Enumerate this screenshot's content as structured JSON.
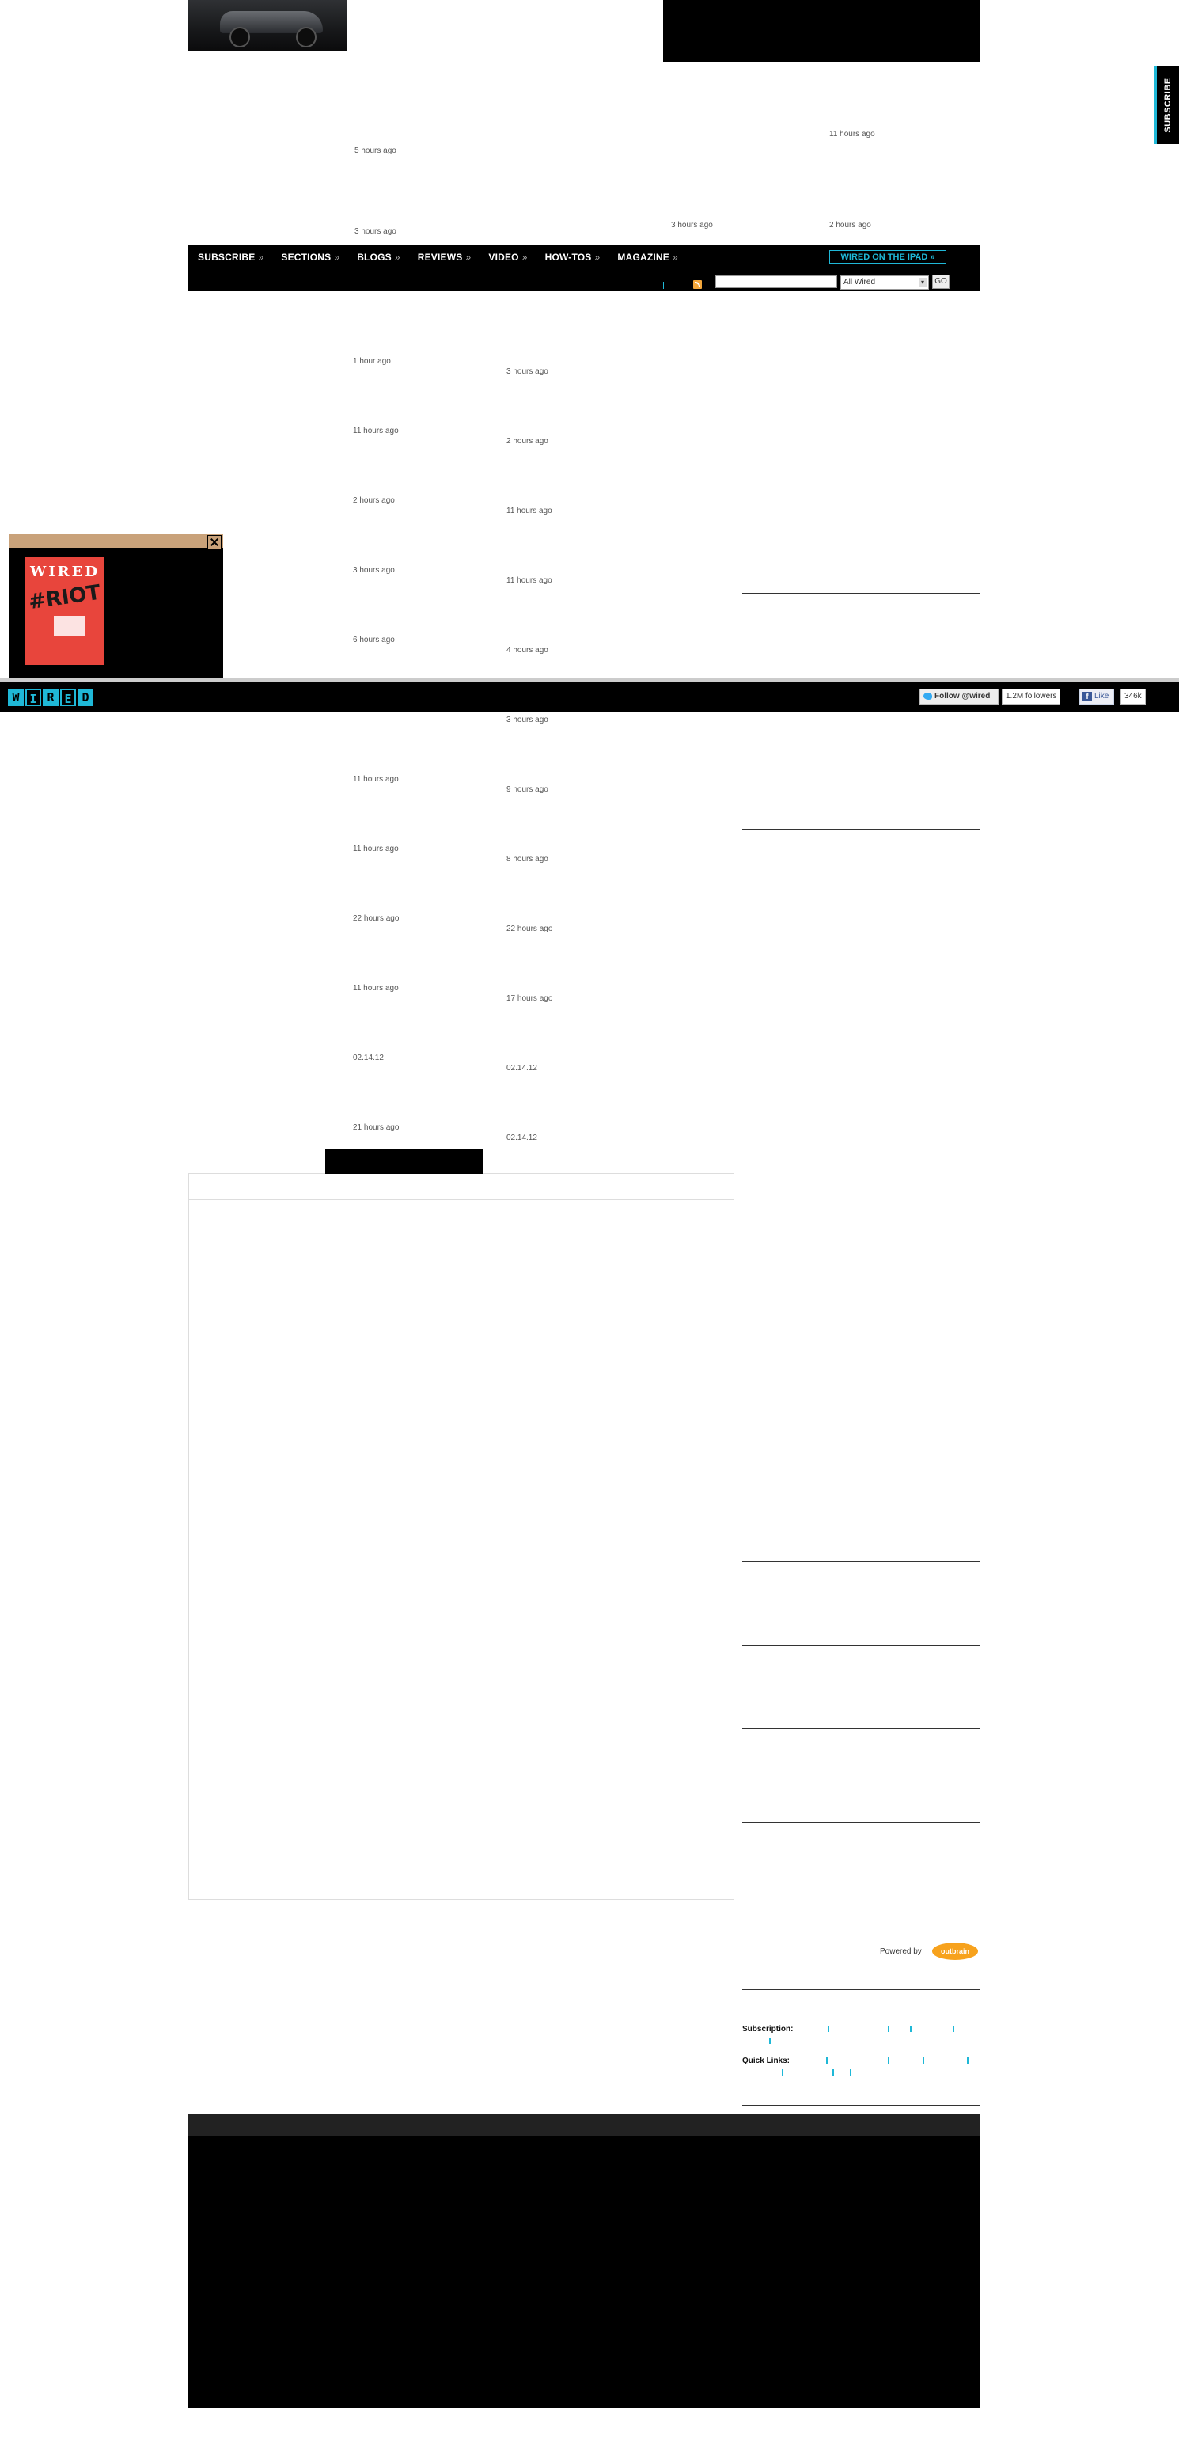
{
  "side_tab": {
    "label": "SUBSCRIBE"
  },
  "nav": {
    "items": [
      {
        "label": "SUBSCRIBE"
      },
      {
        "label": "SECTIONS"
      },
      {
        "label": "BLOGS"
      },
      {
        "label": "REVIEWS"
      },
      {
        "label": "VIDEO"
      },
      {
        "label": "HOW-TOS"
      },
      {
        "label": "MAGAZINE"
      }
    ],
    "ipad_label": "WIRED ON THE IPAD",
    "search_placeholder": "",
    "search_scope": "All Wired",
    "go_label": "GO"
  },
  "timestamps": {
    "hero": [
      "11 hours ago",
      "5 hours ago",
      "3 hours ago",
      "3 hours ago",
      "2 hours ago"
    ],
    "left_col": [
      "1 hour ago",
      "11 hours ago",
      "2 hours ago",
      "3 hours ago",
      "6 hours ago",
      "11 hours ago",
      "11 hours ago",
      "22 hours ago",
      "11 hours ago",
      "02.14.12",
      "21 hours ago"
    ],
    "mid_col": [
      "3 hours ago",
      "2 hours ago",
      "11 hours ago",
      "11 hours ago",
      "4 hours ago",
      "3 hours ago",
      "9 hours ago",
      "8 hours ago",
      "22 hours ago",
      "17 hours ago",
      "02.14.12",
      "02.14.12"
    ]
  },
  "magazine_popup": {
    "cover_masthead": "WIRED",
    "cover_headline": "#RIOT"
  },
  "toolbar": {
    "logo_letters": [
      "W",
      "I",
      "R",
      "E",
      "D"
    ],
    "follow_label": "Follow @wired",
    "followers": "1.2M followers",
    "like_label": "Like",
    "like_count": "346k"
  },
  "outbrain": {
    "powered_by": "Powered by",
    "logo_text": "outbrain"
  },
  "footer": {
    "subscription_label": "Subscription:",
    "quick_links_label": "Quick Links:"
  },
  "colors": {
    "accent": "#1fb8d7",
    "nav_bg": "#000000",
    "rss": "#f4a73b",
    "outbrain": "#f7a21d",
    "magazine_cover": "#e8453c"
  }
}
